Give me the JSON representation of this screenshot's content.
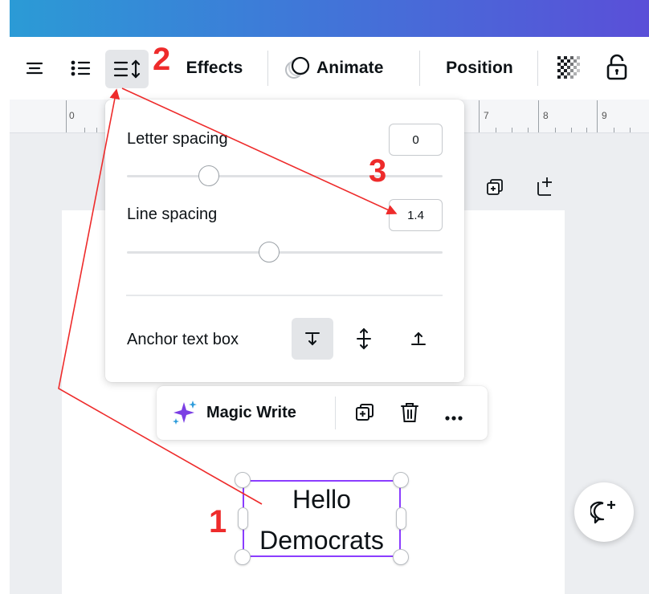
{
  "toolbar": {
    "items": [
      {
        "icon": "align-center-icon"
      },
      {
        "icon": "bulleted-list-icon"
      },
      {
        "icon": "spacing-icon"
      },
      {
        "label": "Effects"
      },
      {
        "label": "Animate",
        "icon": "animate-icon"
      },
      {
        "label": "Position"
      },
      {
        "icon": "transparency-icon"
      },
      {
        "icon": "lock-icon"
      }
    ]
  },
  "ruler": {
    "marks": [
      "0",
      "7",
      "8",
      "9"
    ]
  },
  "spacing_panel": {
    "letter_spacing": {
      "label": "Letter spacing",
      "value": "0",
      "slider_fraction": 0.26
    },
    "line_spacing": {
      "label": "Line spacing",
      "value": "1.4",
      "slider_fraction": 0.45
    },
    "anchor": {
      "label": "Anchor text box",
      "options": [
        "top",
        "middle",
        "bottom"
      ],
      "selected": "top"
    }
  },
  "context_menu": {
    "magic_write_label": "Magic Write"
  },
  "textbox": {
    "lines": [
      "Hello",
      "Democrats"
    ]
  },
  "annotations": {
    "step1": "1",
    "step2": "2",
    "step3": "3",
    "color": "#ee2b2b"
  },
  "colors": {
    "selection": "#8b3dff",
    "magic_write": "#7b3fe4"
  }
}
